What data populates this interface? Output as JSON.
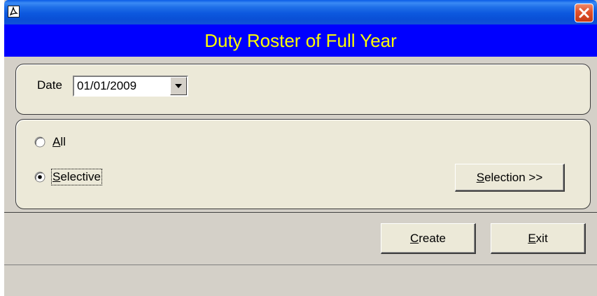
{
  "window": {
    "title": "",
    "app_icon": "acrobat-icon",
    "close_icon": "close-icon",
    "close_color": "#e0502a",
    "titlebar_color": "#0a4fd6"
  },
  "header": {
    "title": "Duty Roster of Full Year",
    "background": "#0000ff",
    "text_color": "#ffff00"
  },
  "date_group": {
    "label": "Date",
    "value": "01/01/2009",
    "dropdown_icon": "chevron-down-icon"
  },
  "selection_group": {
    "options": [
      {
        "label_mnemonic": "A",
        "label_rest": "ll",
        "selected": false
      },
      {
        "label_mnemonic": "S",
        "label_rest": "elective",
        "selected": true
      }
    ],
    "selection_button": {
      "mnemonic": "S",
      "rest": "election >>"
    }
  },
  "footer": {
    "create_button": {
      "mnemonic": "C",
      "rest": "reate"
    },
    "exit_button": {
      "mnemonic": "E",
      "rest": "xit"
    }
  }
}
